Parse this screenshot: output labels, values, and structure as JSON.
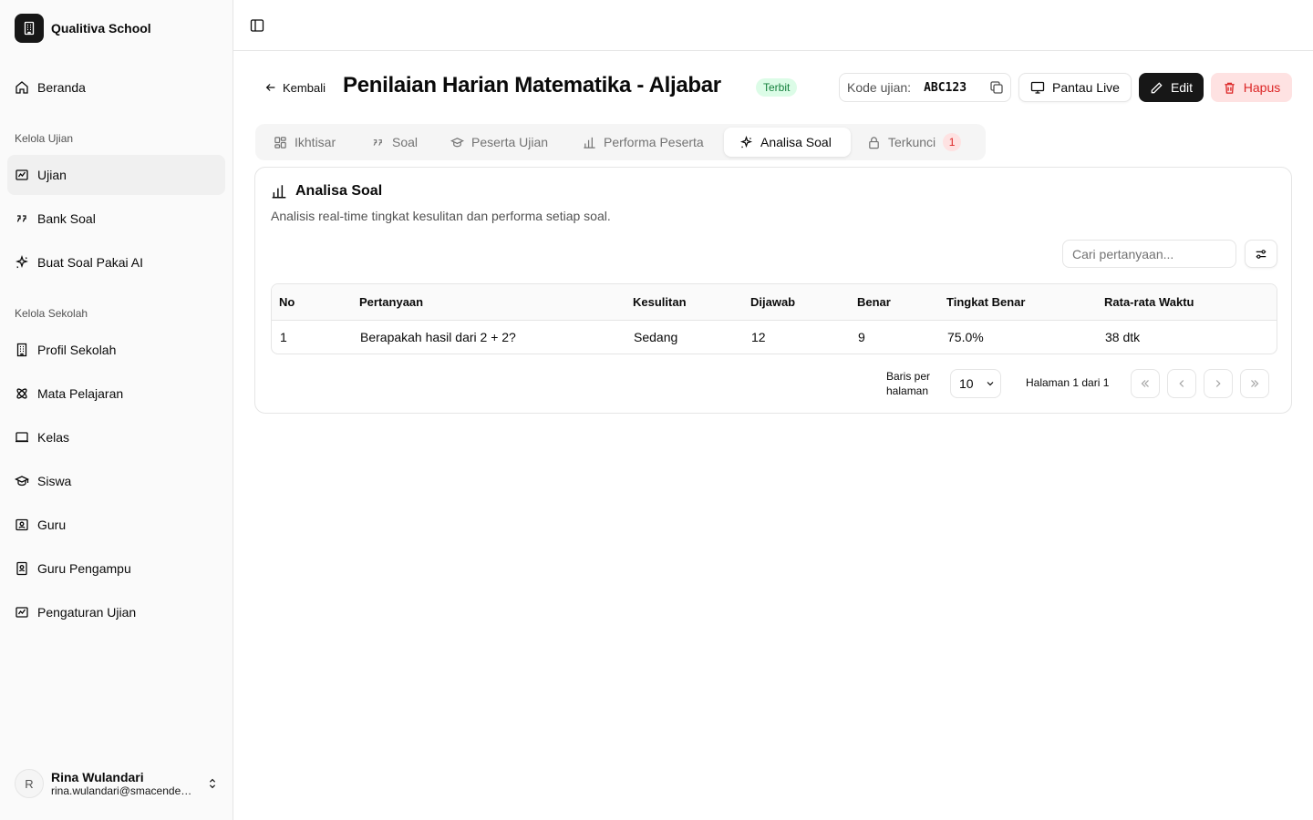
{
  "app": {
    "name": "Qualitiva School"
  },
  "sidebar": {
    "home": "Beranda",
    "group_exam": "Kelola Ujian",
    "exam_items": [
      "Ujian",
      "Bank Soal",
      "Buat Soal Pakai AI"
    ],
    "group_school": "Kelola Sekolah",
    "school_items": [
      "Profil Sekolah",
      "Mata Pelajaran",
      "Kelas",
      "Siswa",
      "Guru",
      "Guru Pengampu",
      "Pengaturan Ujian"
    ]
  },
  "user": {
    "initial": "R",
    "name": "Rina Wulandari",
    "email": "rina.wulandari@smacendekia.sch.id"
  },
  "header": {
    "back": "Kembali",
    "title": "Penilaian Harian Matematika - Aljabar",
    "status": "Terbit",
    "code_label": "Kode ujian:",
    "code_value": "ABC123",
    "live": "Pantau Live",
    "edit": "Edit",
    "delete": "Hapus"
  },
  "tabs": [
    {
      "label": "Ikhtisar"
    },
    {
      "label": "Soal"
    },
    {
      "label": "Peserta Ujian"
    },
    {
      "label": "Performa Peserta"
    },
    {
      "label": "Analisa Soal"
    },
    {
      "label": "Terkunci",
      "count": "1"
    }
  ],
  "card": {
    "title": "Analisa Soal",
    "description": "Analisis real-time tingkat kesulitan dan performa setiap soal.",
    "search_placeholder": "Cari pertanyaan..."
  },
  "table": {
    "headers": [
      "No",
      "Pertanyaan",
      "Kesulitan",
      "Dijawab",
      "Benar",
      "Tingkat Benar",
      "Rata-rata Waktu"
    ],
    "rows": [
      [
        "1",
        "Berapakah hasil dari 2 + 2?",
        "Sedang",
        "12",
        "9",
        "75.0%",
        "38 dtk"
      ]
    ]
  },
  "pagination": {
    "rows_per_page_label": "Baris per halaman",
    "rows_per_page": "10",
    "page_info": "Halaman 1 dari 1"
  },
  "colors": {
    "primary": "#171717",
    "danger": "#dc2626",
    "success": "#15803d"
  }
}
